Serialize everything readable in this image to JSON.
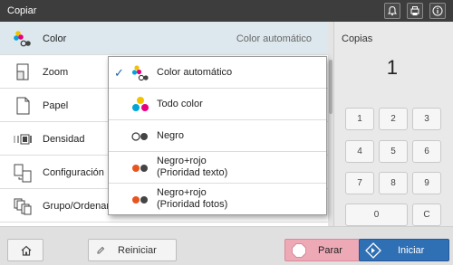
{
  "topbar": {
    "title": "Copiar",
    "icons": [
      "bell-icon",
      "device-status-icon",
      "info-icon"
    ]
  },
  "function_list": [
    {
      "label": "Color",
      "value": "Color automático",
      "icon": "color-icon"
    },
    {
      "label": "Zoom",
      "value": "",
      "icon": "zoom-icon"
    },
    {
      "label": "Papel",
      "value": "",
      "icon": "paper-icon"
    },
    {
      "label": "Densidad",
      "value": "",
      "icon": "density-icon"
    },
    {
      "label": "Configuración",
      "value": "",
      "icon": "configuration-icon"
    },
    {
      "label": "Grupo/Ordenar",
      "value": "",
      "icon": "group-sort-icon"
    }
  ],
  "color_dropdown": {
    "selected": "Color automático",
    "options": [
      {
        "label_line1": "Color automático",
        "label_line2": "",
        "icon": "auto-color-icon"
      },
      {
        "label_line1": "Todo color",
        "label_line2": "",
        "icon": "full-color-icon"
      },
      {
        "label_line1": "Negro",
        "label_line2": "",
        "icon": "black-icon"
      },
      {
        "label_line1": "Negro+rojo",
        "label_line2": "(Prioridad texto)",
        "icon": "black-red-text-icon"
      },
      {
        "label_line1": "Negro+rojo",
        "label_line2": "(Prioridad fotos)",
        "icon": "black-red-photo-icon"
      }
    ]
  },
  "copies": {
    "label": "Copias",
    "value": "1"
  },
  "keypad": [
    "1",
    "2",
    "3",
    "4",
    "5",
    "6",
    "7",
    "8",
    "9",
    "0",
    "C"
  ],
  "bottom": {
    "reset_label": "Reiniciar",
    "stop_label": "Parar",
    "start_label": "Iniciar"
  },
  "colors": {
    "topbar": "#3d3d3d",
    "selected_row": "#dde8ee",
    "stop": "#eea9b6",
    "start": "#2f6fb3",
    "check": "#1f5fa8"
  }
}
